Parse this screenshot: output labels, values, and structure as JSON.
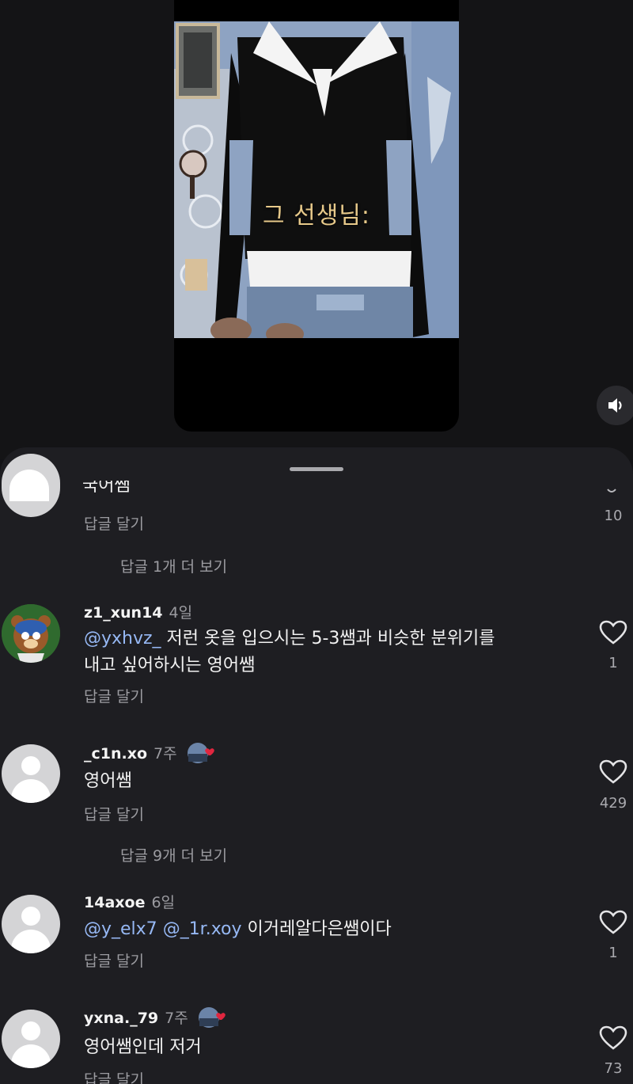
{
  "video": {
    "caption": "그 선생님:",
    "volume_icon": "speaker-icon"
  },
  "comments_partial": {
    "clipped_text": "국어쌤",
    "reply_label": "답글 달기",
    "likes": "10"
  },
  "view_more_1": "답글 1개 더 보기",
  "comments": [
    {
      "username": "z1_xun14",
      "time": "4일",
      "mention": "@yxhvz_",
      "text_line1": " 저런 옷을 입으시는 5-3쌤과 비슷한 분위기를",
      "text_line2": "내고 싶어하시는 영어쌤",
      "reply_label": "답글 달기",
      "likes": "1"
    },
    {
      "username": "_c1n.xo",
      "time": "7주",
      "text": "영어쌤",
      "reply_label": "답글 달기",
      "likes": "429"
    },
    {
      "username": "14axoe",
      "time": "6일",
      "mention1": "@y_elx7",
      "mention2": "@_1r.xoy",
      "text": " 이거레알다은쌤이다",
      "reply_label": "답글 달기",
      "likes": "1"
    },
    {
      "username": "yxna._79",
      "time": "7주",
      "text": "영어쌤인데 저거",
      "reply_label": "답글 달기",
      "likes": "73"
    }
  ],
  "view_more_2": "답글 9개 더 보기",
  "colors": {
    "sheet_bg": "#1e1e22",
    "mention": "#96b8f4",
    "caption": "#e7c98a",
    "heart_badge": "#e0263f"
  }
}
